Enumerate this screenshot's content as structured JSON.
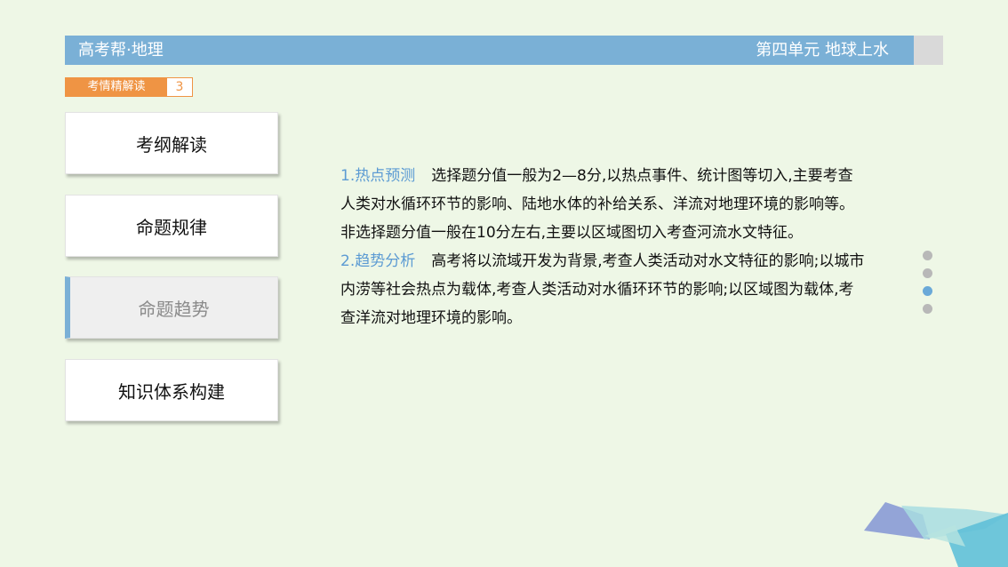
{
  "header": {
    "left_title": "高考帮·地理",
    "right_title": "第四单元 地球上水"
  },
  "tag": {
    "label": "考情精解读",
    "number": "3"
  },
  "menu": {
    "items": [
      {
        "label": "考纲解读"
      },
      {
        "label": "命题规律"
      },
      {
        "label": "命题趋势"
      },
      {
        "label": "知识体系构建"
      }
    ]
  },
  "content": {
    "sections": [
      {
        "title": "1.热点预测",
        "text": "选择题分值一般为2—8分,以热点事件、统计图等切入,主要考查人类对水循环环节的影响、陆地水体的补给关系、洋流对地理环境的影响等。非选择题分值一般在10分左右,主要以区域图切入考查河流水文特征。"
      },
      {
        "title": "2.趋势分析",
        "text": "高考将以流域开发为背景,考查人类活动对水文特征的影响;以城市内涝等社会热点为载体,考查人类活动对水循环环节的影响;以区域图为载体,考查洋流对地理环境的影响。"
      }
    ]
  },
  "pagination": {
    "total": 4,
    "active_index": 2
  },
  "colors": {
    "header_blue": "#7ab0d6",
    "tag_orange": "#ef9444",
    "section_title_blue": "#5c9bd3",
    "background": "#eef7e6"
  }
}
